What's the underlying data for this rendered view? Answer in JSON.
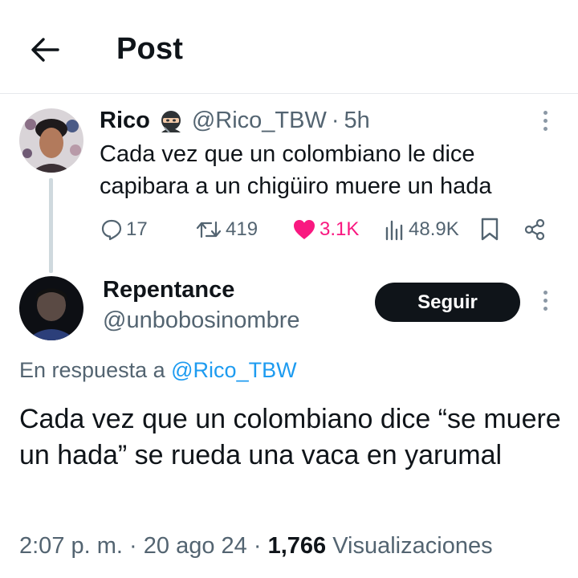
{
  "header": {
    "title": "Post",
    "back_icon": "arrow-left-icon"
  },
  "original_post": {
    "display_name": "Rico",
    "name_emoji": "ninja-emoji",
    "handle": "@Rico_TBW",
    "separator": "·",
    "time": "5h",
    "text": "Cada vez que un colombiano le dice capibara a un chigüiro muere un hada",
    "stats": {
      "replies": "17",
      "reposts": "419",
      "likes": "3.1K",
      "views": "48.9K"
    },
    "liked": true,
    "like_color": "#f91880"
  },
  "reply_post": {
    "display_name": "Repentance",
    "handle": "@unbobosinombre",
    "follow_label": "Seguir",
    "reply_prefix": "En respuesta a",
    "reply_mention": "@Rico_TBW",
    "text": "Cada vez que un colombiano dice “se muere un hada” se rueda una vaca en yarumal",
    "time": "2:07 p. m.",
    "dot": "·",
    "date": "20 ago 24",
    "views_count": "1,766",
    "views_label": "Visualizaciones"
  },
  "colors": {
    "accent": "#1d9bf0",
    "text": "#0f1419",
    "secondary": "#536471",
    "divider": "#e6e9ec"
  }
}
